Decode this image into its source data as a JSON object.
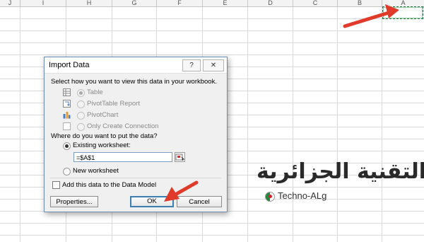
{
  "spreadsheet": {
    "column_headers": [
      "J",
      "I",
      "H",
      "G",
      "F",
      "E",
      "D",
      "C",
      "B",
      "A"
    ],
    "selected_cell": "A1"
  },
  "dialog": {
    "title": "Import Data",
    "help_glyph": "?",
    "close_glyph": "✕",
    "view_prompt": "Select how you want to view this data in your workbook.",
    "view_options": [
      {
        "label": "Table",
        "selected": true,
        "enabled": false,
        "icon": "table-icon"
      },
      {
        "label": "PivotTable Report",
        "selected": false,
        "enabled": false,
        "icon": "pivottable-icon"
      },
      {
        "label": "PivotChart",
        "selected": false,
        "enabled": false,
        "icon": "pivotchart-icon"
      },
      {
        "label": "Only Create Connection",
        "selected": false,
        "enabled": false,
        "icon": "connection-icon"
      }
    ],
    "location_prompt": "Where do you want to put the data?",
    "existing_label": "Existing worksheet:",
    "existing_selected": true,
    "reference_value": "=$A$1",
    "new_label": "New worksheet",
    "data_model_label": "Add this data to the Data Model",
    "data_model_checked": false,
    "properties_label": "Properties...",
    "ok_label": "OK",
    "cancel_label": "Cancel"
  },
  "watermark": {
    "arabic": "التقنية الجزائرية",
    "latin": "Techno-ALg"
  },
  "colors": {
    "arrow": "#e03a2a",
    "selection": "#217346",
    "dialog_border": "#6a8db3",
    "default_button_border": "#3c7fb1"
  }
}
